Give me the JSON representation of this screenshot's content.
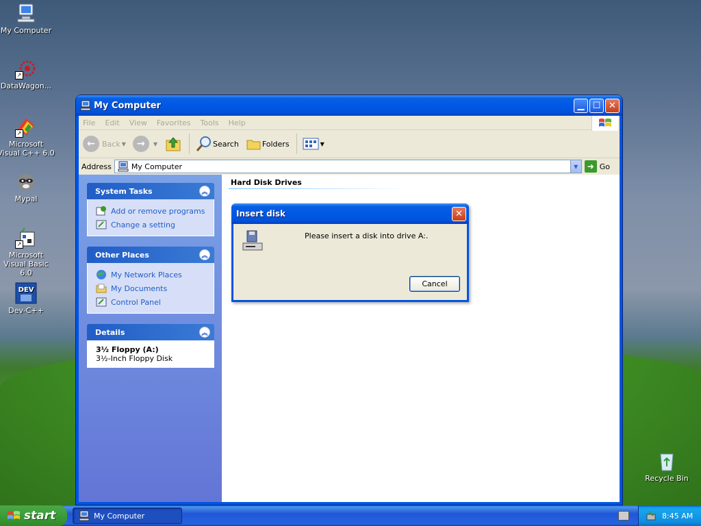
{
  "desktop": {
    "icons": [
      {
        "label": "My Computer"
      },
      {
        "label": "DataWagon..."
      },
      {
        "label": "Microsoft Visual C++ 6.0"
      },
      {
        "label": "Mypal"
      },
      {
        "label": "Microsoft Visual Basic 6.0"
      },
      {
        "label": "Dev-C++"
      },
      {
        "label": "Recycle Bin"
      }
    ],
    "dev_icon_text": "DEV"
  },
  "window": {
    "title": "My Computer",
    "menu": [
      "File",
      "Edit",
      "View",
      "Favorites",
      "Tools",
      "Help"
    ],
    "toolbar": {
      "back": "Back",
      "search": "Search",
      "folders": "Folders"
    },
    "address": {
      "label": "Address",
      "value": "My Computer",
      "go": "Go"
    },
    "system_tasks": {
      "title": "System Tasks",
      "items": [
        "Add or remove programs",
        "Change a setting"
      ]
    },
    "other_places": {
      "title": "Other Places",
      "items": [
        "My Network Places",
        "My Documents",
        "Control Panel"
      ]
    },
    "details": {
      "title": "Details",
      "name": "3½ Floppy (A:)",
      "type": "3½-Inch Floppy Disk"
    },
    "group_header": "Hard Disk Drives"
  },
  "dialog": {
    "title": "Insert disk",
    "message": "Please insert a disk into drive A:.",
    "cancel": "Cancel"
  },
  "taskbar": {
    "start": "start",
    "task": "My Computer",
    "clock": "8:45 AM"
  },
  "colors": {
    "title_blue": "#0058e6",
    "panel_link": "#215dc6",
    "start_green": "#3e9f3c"
  }
}
